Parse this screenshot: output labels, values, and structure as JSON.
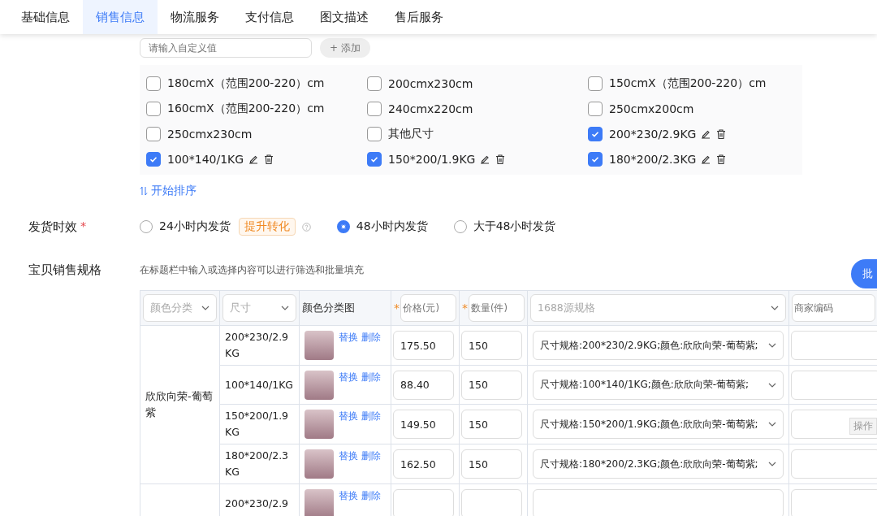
{
  "tabs": [
    {
      "label": "基础信息",
      "selected": false
    },
    {
      "label": "销售信息",
      "selected": true
    },
    {
      "label": "物流服务",
      "selected": false
    },
    {
      "label": "支付信息",
      "selected": false
    },
    {
      "label": "图文描述",
      "selected": false
    },
    {
      "label": "售后服务",
      "selected": false
    }
  ],
  "custom_value": {
    "placeholder": "请输入自定义值",
    "add_button": "+ 添加"
  },
  "size_options": [
    {
      "label": "180cmX（范围200-220）cm",
      "checked": false,
      "kind": "preset"
    },
    {
      "label": "200cmx230cm",
      "checked": false,
      "kind": "preset"
    },
    {
      "label": "150cmX（范围200-220）cm",
      "checked": false,
      "kind": "preset"
    },
    {
      "label": "160cmX（范围200-220）cm",
      "checked": false,
      "kind": "preset"
    },
    {
      "label": "240cmx220cm",
      "checked": false,
      "kind": "preset"
    },
    {
      "label": "250cmx200cm",
      "checked": false,
      "kind": "preset"
    },
    {
      "label": "250cmx230cm",
      "checked": false,
      "kind": "preset"
    },
    {
      "label": "其他尺寸",
      "checked": false,
      "kind": "preset"
    },
    {
      "label": "200*230/2.9KG",
      "checked": true,
      "kind": "custom"
    },
    {
      "label": "100*140/1KG",
      "checked": true,
      "kind": "custom"
    },
    {
      "label": "150*200/1.9KG",
      "checked": true,
      "kind": "custom"
    },
    {
      "label": "180*200/2.3KG",
      "checked": true,
      "kind": "custom"
    }
  ],
  "sort_link": "开始排序",
  "delivery": {
    "label": "发货时效",
    "required_mark": "*",
    "options": [
      {
        "label": "24小时内发货",
        "selected": false,
        "badge": "提升转化",
        "help": true
      },
      {
        "label": "48小时内发货",
        "selected": true
      },
      {
        "label": "大于48小时发货",
        "selected": false
      }
    ]
  },
  "sku": {
    "label": "宝贝销售规格",
    "hint": "在标题栏中输入或选择内容可以进行筛选和批量填充",
    "batch_button": "批",
    "operate_tag": "操作",
    "columns": [
      {
        "label": "颜色分类",
        "kind": "select"
      },
      {
        "label": "尺寸",
        "kind": "select"
      },
      {
        "label": "颜色分类图",
        "kind": "text"
      },
      {
        "placeholder": "价格(元)",
        "kind": "input",
        "required_mark": "*"
      },
      {
        "placeholder": "数量(件)",
        "kind": "input",
        "required_mark": "*"
      },
      {
        "label": "1688源规格",
        "kind": "select"
      },
      {
        "placeholder": "商家编码",
        "kind": "input"
      }
    ],
    "groups": [
      {
        "name": "欣欣向荣-葡萄紫",
        "rows": [
          {
            "size": "200*230/2.9KG",
            "actions": [
              "替换",
              "删除"
            ],
            "price": "175.50",
            "quantity": "150",
            "source_spec": "尺寸规格:200*230/2.9KG;颜色:欣欣向荣-葡萄紫;"
          },
          {
            "size": "100*140/1KG",
            "actions": [
              "替换",
              "删除"
            ],
            "price": "88.40",
            "quantity": "150",
            "source_spec": "尺寸规格:100*140/1KG;颜色:欣欣向荣-葡萄紫;"
          },
          {
            "size": "150*200/1.9KG",
            "actions": [
              "替换",
              "删除"
            ],
            "price": "149.50",
            "quantity": "150",
            "source_spec": "尺寸规格:150*200/1.9KG;颜色:欣欣向荣-葡萄紫;"
          },
          {
            "size": "180*200/2.3KG",
            "actions": [
              "替换",
              "删除"
            ],
            "price": "162.50",
            "quantity": "150",
            "source_spec": "尺寸规格:180*200/2.3KG;颜色:欣欣向荣-葡萄紫;"
          }
        ]
      },
      {
        "rows": [
          {
            "size": "200*230/2.9",
            "actions": [
              "替换",
              "删除"
            ]
          }
        ]
      }
    ]
  }
}
